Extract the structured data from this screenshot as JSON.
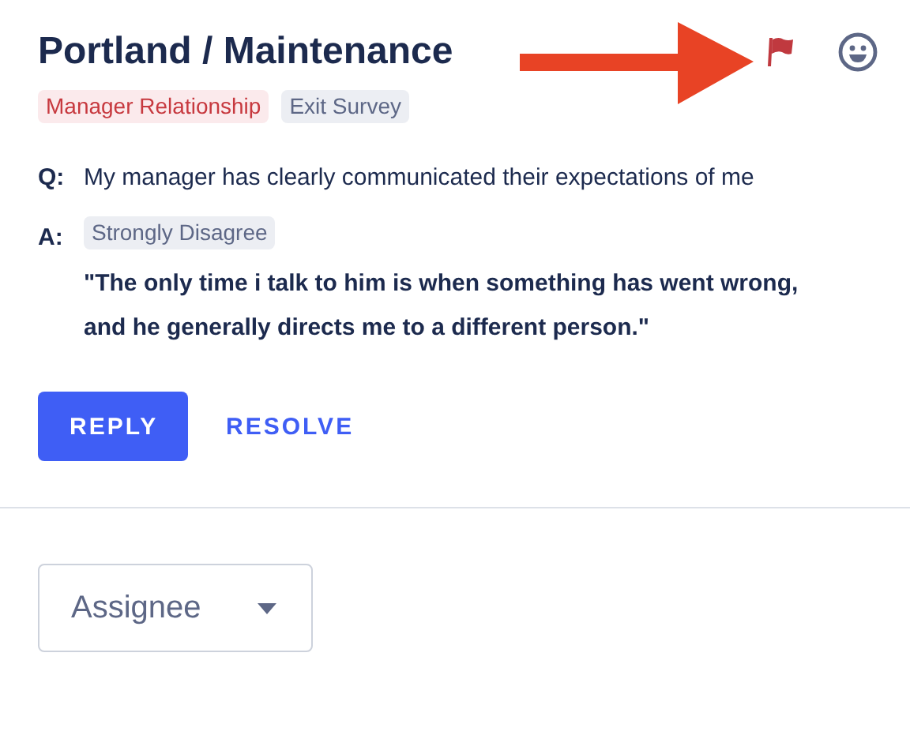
{
  "header": {
    "title": "Portland / Maintenance",
    "flagged": true
  },
  "tags": [
    {
      "label": "Manager Relationship",
      "kind": "topic"
    },
    {
      "label": "Exit Survey",
      "kind": "source"
    }
  ],
  "question": {
    "prefix": "Q:",
    "text": "My manager has clearly communicated their expectations of me"
  },
  "answer": {
    "prefix": "A:",
    "rating": "Strongly Disagree",
    "comment": "\"The only time i talk to him is when something has went wrong, and he generally directs me to a different person.\""
  },
  "buttons": [
    {
      "label": "REPLY",
      "kind": "primary"
    },
    {
      "label": "RESOLVE",
      "kind": "text"
    }
  ],
  "assignee": {
    "placeholder": "Assignee"
  }
}
